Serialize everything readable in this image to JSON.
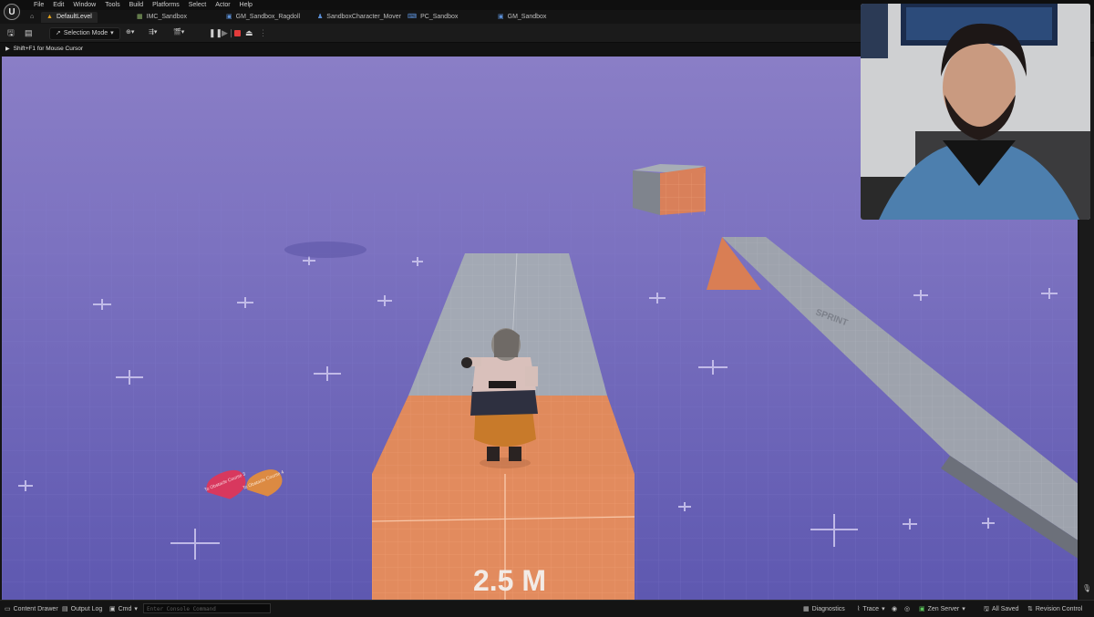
{
  "menubar": {
    "items": [
      "File",
      "Edit",
      "Window",
      "Tools",
      "Build",
      "Platforms",
      "Select",
      "Actor",
      "Help"
    ]
  },
  "tabs": [
    {
      "label": "DefaultLevel",
      "icon": "level-icon",
      "active": true
    },
    {
      "label": "IMC_Sandbox",
      "icon": "input-mapping-icon"
    },
    {
      "label": "GM_Sandbox_Ragdoll",
      "icon": "blueprint-icon"
    },
    {
      "label": "SandboxCharacter_Mover",
      "icon": "character-icon"
    },
    {
      "label": "PC_Sandbox",
      "icon": "controller-icon"
    },
    {
      "label": "GM_Sandbox",
      "icon": "blueprint-icon"
    }
  ],
  "toolbar": {
    "mode_label": "Selection Mode"
  },
  "viewport": {
    "hint": "Shift+F1 for Mouse Cursor",
    "block_label": "2.5 M",
    "ramp_label": "SPRINT",
    "sign_left": "To Obstacle Course 3",
    "sign_right": "To Obstacle Course 4"
  },
  "statusbar": {
    "content_drawer": "Content Drawer",
    "output_log": "Output Log",
    "cmd": "Cmd",
    "console_placeholder": "Enter Console Command",
    "diagnostics": "Diagnostics",
    "trace": "Trace",
    "zen_server": "Zen Server",
    "saved": "All Saved",
    "revision_control": "Revision Control"
  },
  "colors": {
    "floor": "#6f68b8",
    "sky": "#8a7fd0",
    "orange_block": "#e08a5c",
    "grey_block": "#a3a9b4"
  }
}
